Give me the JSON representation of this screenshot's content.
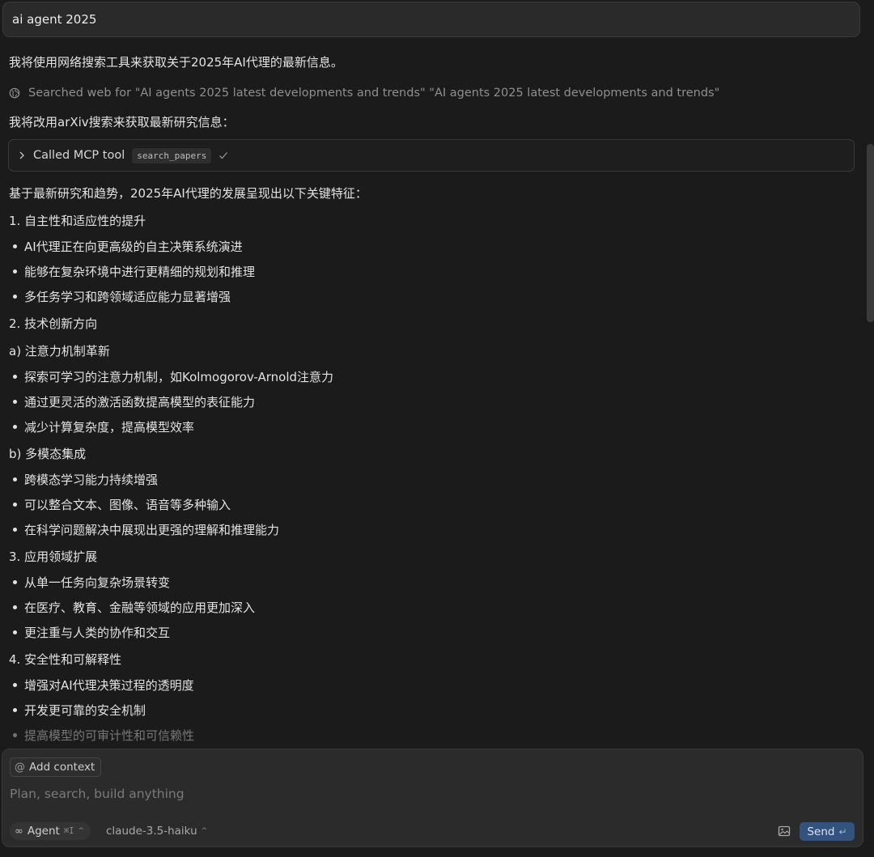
{
  "query": "ai agent 2025",
  "intro": "我将使用网络搜索工具来获取关于2025年AI代理的最新信息。",
  "search": {
    "icon": "globe-icon",
    "text": "Searched web for \"AI agents 2025 latest developments and trends\" \"AI agents 2025 latest developments and trends\""
  },
  "arxiv_line": "我将改用arXiv搜索来获取最新研究信息：",
  "tool_call": {
    "label": "Called MCP tool",
    "tool_name": "search_papers",
    "status_icon": "check-icon"
  },
  "summary_intro": "基于最新研究和趋势，2025年AI代理的发展呈现出以下关键特征：",
  "sections": [
    {
      "type": "heading",
      "text": "1. 自主性和适应性的提升"
    },
    {
      "type": "bullet",
      "text": "AI代理正在向更高级的自主决策系统演进"
    },
    {
      "type": "bullet",
      "text": "能够在复杂环境中进行更精细的规划和推理"
    },
    {
      "type": "bullet",
      "text": "多任务学习和跨领域适应能力显著增强"
    },
    {
      "type": "heading",
      "text": "2. 技术创新方向"
    },
    {
      "type": "heading",
      "text": "a) 注意力机制革新"
    },
    {
      "type": "bullet",
      "text": "探索可学习的注意力机制，如Kolmogorov-Arnold注意力"
    },
    {
      "type": "bullet",
      "text": "通过更灵活的激活函数提高模型的表征能力"
    },
    {
      "type": "bullet",
      "text": "减少计算复杂度，提高模型效率"
    },
    {
      "type": "heading",
      "text": "b) 多模态集成"
    },
    {
      "type": "bullet",
      "text": "跨模态学习能力持续增强"
    },
    {
      "type": "bullet",
      "text": "可以整合文本、图像、语音等多种输入"
    },
    {
      "type": "bullet",
      "text": "在科学问题解决中展现出更强的理解和推理能力"
    },
    {
      "type": "heading",
      "text": "3. 应用领域扩展"
    },
    {
      "type": "bullet",
      "text": "从单一任务向复杂场景转变"
    },
    {
      "type": "bullet",
      "text": "在医疗、教育、金融等领域的应用更加深入"
    },
    {
      "type": "bullet",
      "text": "更注重与人类的协作和交互"
    },
    {
      "type": "heading",
      "text": "4. 安全性和可解释性"
    },
    {
      "type": "bullet",
      "text": "增强对AI代理决策过程的透明度"
    },
    {
      "type": "bullet",
      "text": "开发更可靠的安全机制"
    },
    {
      "type": "bullet",
      "text": "提高模型的可审计性和可信赖性"
    }
  ],
  "composer": {
    "add_context": "Add context",
    "placeholder": "Plan, search, build anything",
    "mode": "Agent",
    "mode_shortcut": "⌘I",
    "model": "claude-3.5-haiku",
    "send_label": "Send"
  }
}
